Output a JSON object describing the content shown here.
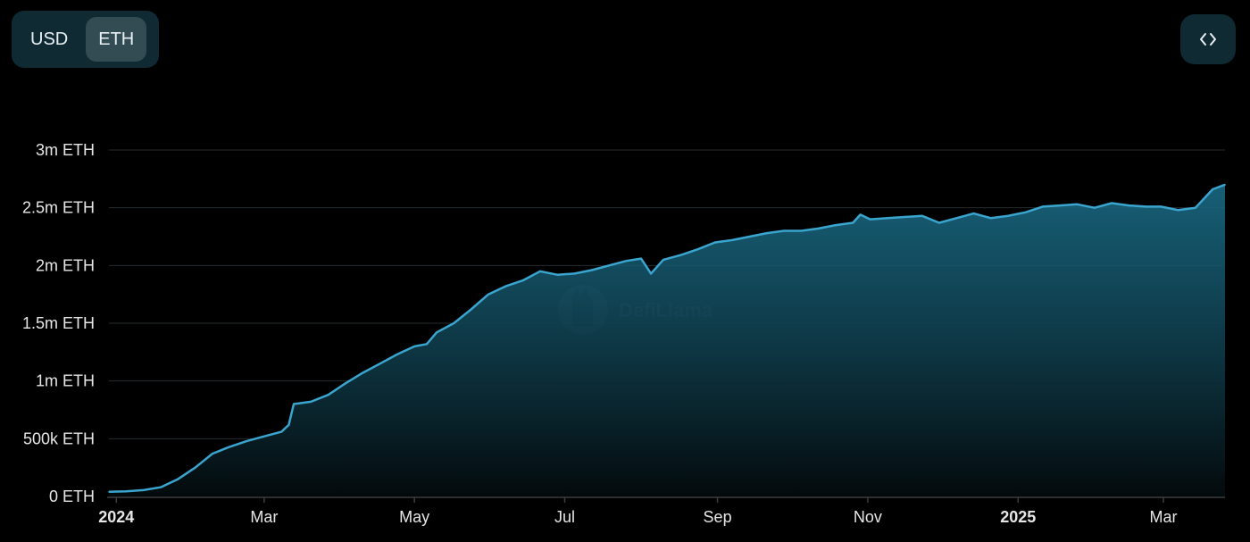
{
  "toolbar": {
    "denomination_options": [
      "USD",
      "ETH"
    ],
    "selected": "ETH",
    "embed_icon": "code-brackets-icon"
  },
  "watermark": {
    "text": "DefiLlama",
    "icon": "llama-logo-icon"
  },
  "colors": {
    "line": "#3aa5cf",
    "area_top": "#1b6f8b",
    "area_bottom": "#030a0c",
    "grid": "#262b2e",
    "axis": "#3a3f42",
    "tick_text": "#e6e6e6"
  },
  "chart_data": {
    "type": "area",
    "title": "",
    "xlabel": "",
    "ylabel": "",
    "y_unit": "ETH",
    "ylim": [
      0,
      3000000
    ],
    "yticks": [
      0,
      500000,
      1000000,
      1500000,
      2000000,
      2500000,
      3000000
    ],
    "ytick_labels": [
      "0 ETH",
      "500k ETH",
      "1m ETH",
      "1.5m ETH",
      "2m ETH",
      "2.5m ETH",
      "3m ETH"
    ],
    "xlim": [
      "2023-12-29",
      "2025-03-26"
    ],
    "xticks": [
      "2024-01-01",
      "2024-03-01",
      "2024-05-01",
      "2024-07-01",
      "2024-09-01",
      "2024-11-01",
      "2025-01-01",
      "2025-03-01"
    ],
    "xtick_labels": [
      "2024",
      "Mar",
      "May",
      "Jul",
      "Sep",
      "Nov",
      "2025",
      "Mar"
    ],
    "xtick_bold": [
      true,
      false,
      false,
      false,
      false,
      false,
      true,
      false
    ],
    "grid": true,
    "legend": "none",
    "series": [
      {
        "x": [
          "2023-12-29",
          "2024-01-05",
          "2024-01-12",
          "2024-01-19",
          "2024-01-26",
          "2024-02-02",
          "2024-02-09",
          "2024-02-16",
          "2024-02-23",
          "2024-03-01",
          "2024-03-08",
          "2024-03-11",
          "2024-03-13",
          "2024-03-20",
          "2024-03-27",
          "2024-04-03",
          "2024-04-10",
          "2024-04-17",
          "2024-04-24",
          "2024-05-01",
          "2024-05-06",
          "2024-05-10",
          "2024-05-17",
          "2024-05-24",
          "2024-05-31",
          "2024-06-07",
          "2024-06-14",
          "2024-06-21",
          "2024-06-28",
          "2024-07-05",
          "2024-07-12",
          "2024-07-19",
          "2024-07-26",
          "2024-08-01",
          "2024-08-05",
          "2024-08-10",
          "2024-08-17",
          "2024-08-24",
          "2024-08-31",
          "2024-09-07",
          "2024-09-14",
          "2024-09-21",
          "2024-09-28",
          "2024-10-05",
          "2024-10-12",
          "2024-10-19",
          "2024-10-26",
          "2024-10-29",
          "2024-11-02",
          "2024-11-09",
          "2024-11-16",
          "2024-11-23",
          "2024-11-30",
          "2024-12-07",
          "2024-12-14",
          "2024-12-21",
          "2024-12-28",
          "2025-01-04",
          "2025-01-11",
          "2025-01-18",
          "2025-01-25",
          "2025-02-01",
          "2025-02-08",
          "2025-02-15",
          "2025-02-22",
          "2025-02-28",
          "2025-03-07",
          "2025-03-14",
          "2025-03-21",
          "2025-03-26"
        ],
        "values": [
          40000,
          45000,
          55000,
          80000,
          150000,
          250000,
          370000,
          430000,
          480000,
          520000,
          560000,
          620000,
          800000,
          820000,
          880000,
          980000,
          1070000,
          1150000,
          1230000,
          1300000,
          1320000,
          1420000,
          1500000,
          1620000,
          1750000,
          1820000,
          1870000,
          1950000,
          1920000,
          1930000,
          1960000,
          2000000,
          2040000,
          2060000,
          1930000,
          2050000,
          2090000,
          2140000,
          2200000,
          2220000,
          2250000,
          2280000,
          2300000,
          2300000,
          2320000,
          2350000,
          2370000,
          2440000,
          2400000,
          2410000,
          2420000,
          2430000,
          2370000,
          2410000,
          2450000,
          2410000,
          2430000,
          2460000,
          2510000,
          2520000,
          2530000,
          2500000,
          2540000,
          2520000,
          2510000,
          2510000,
          2480000,
          2500000,
          2660000,
          2700000
        ]
      }
    ]
  }
}
